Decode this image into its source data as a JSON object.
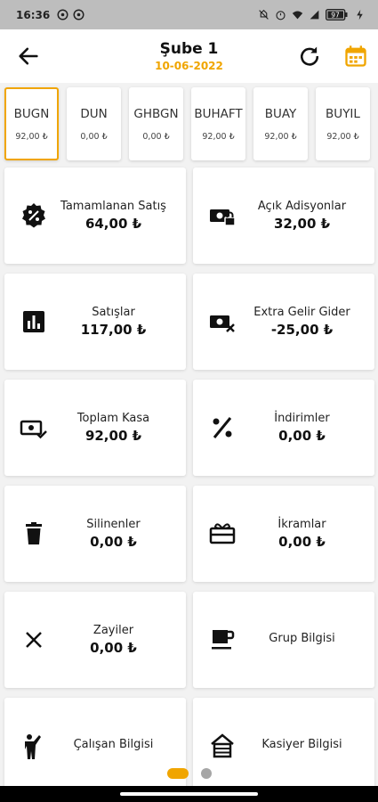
{
  "status": {
    "time": "16:36",
    "battery_icon": "battery-charging-icon",
    "battery_label": "97"
  },
  "header": {
    "title": "Şube 1",
    "date": "10-06-2022",
    "back_icon": "arrow-back-icon",
    "refresh_icon": "refresh-icon",
    "calendar_icon": "calendar-icon",
    "accent_color": "#f0a500"
  },
  "periods": [
    {
      "label": "BUGN",
      "value": "92,00 ₺"
    },
    {
      "label": "DUN",
      "value": "0,00 ₺"
    },
    {
      "label": "GHBGN",
      "value": "0,00 ₺"
    },
    {
      "label": "BUHAFT",
      "value": "92,00 ₺"
    },
    {
      "label": "BUAY",
      "value": "92,00 ₺"
    },
    {
      "label": "BUYIL",
      "value": "92,00 ₺"
    }
  ],
  "cards": [
    {
      "title": "Tamamlanan Satış",
      "value": "64,00 ₺",
      "icon": "discount-badge-icon"
    },
    {
      "title": "Açık Adisyonlar",
      "value": "32,00 ₺",
      "icon": "cash-lock-icon"
    },
    {
      "title": "Satışlar",
      "value": "117,00 ₺",
      "icon": "bar-chart-icon"
    },
    {
      "title": "Extra Gelir Gider",
      "value": "-25,00 ₺",
      "icon": "cash-remove-icon"
    },
    {
      "title": "Toplam Kasa",
      "value": "92,00 ₺",
      "icon": "cash-check-icon"
    },
    {
      "title": "İndirimler",
      "value": "0,00 ₺",
      "icon": "percent-icon"
    },
    {
      "title": "Silinenler",
      "value": "0,00 ₺",
      "icon": "trash-icon"
    },
    {
      "title": "İkramlar",
      "value": "0,00 ₺",
      "icon": "gift-icon"
    },
    {
      "title": "Zayiler",
      "value": "0,00 ₺",
      "icon": "close-icon"
    },
    {
      "title": "Grup Bilgisi",
      "value": "",
      "icon": "coffee-icon"
    },
    {
      "title": "Çalışan Bilgisi",
      "value": "",
      "icon": "person-icon"
    },
    {
      "title": "Kasiyer Bilgisi",
      "value": "",
      "icon": "house-stack-icon"
    }
  ],
  "pager": {
    "pages": 2,
    "current": 1
  }
}
